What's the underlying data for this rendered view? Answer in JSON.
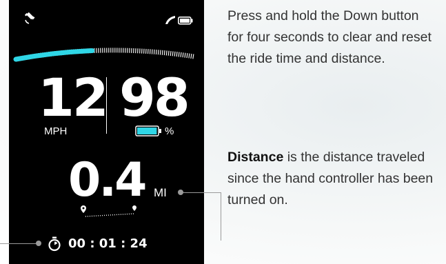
{
  "display": {
    "speed": "12",
    "speed_unit": "MPH",
    "battery_pct": "98",
    "battery_unit": "%",
    "battery_level_fraction": 0.98,
    "speed_gauge_fraction": 0.43,
    "distance": "0.4",
    "distance_unit": "MI",
    "ride_time": "00 : 01 : 24",
    "icons": {
      "gps": "satellite-icon",
      "signal": "signal-icon",
      "battery": "battery-icon",
      "route": "route-icon",
      "timer": "stopwatch-icon"
    },
    "accent_color": "#2fd6e6"
  },
  "annotations": {
    "reset_text": "Press and hold the Down button for four seconds to clear and reset the ride time and distance.",
    "distance_term": "Distance",
    "distance_text": " is the distance traveled since the hand controller has been turned on."
  }
}
